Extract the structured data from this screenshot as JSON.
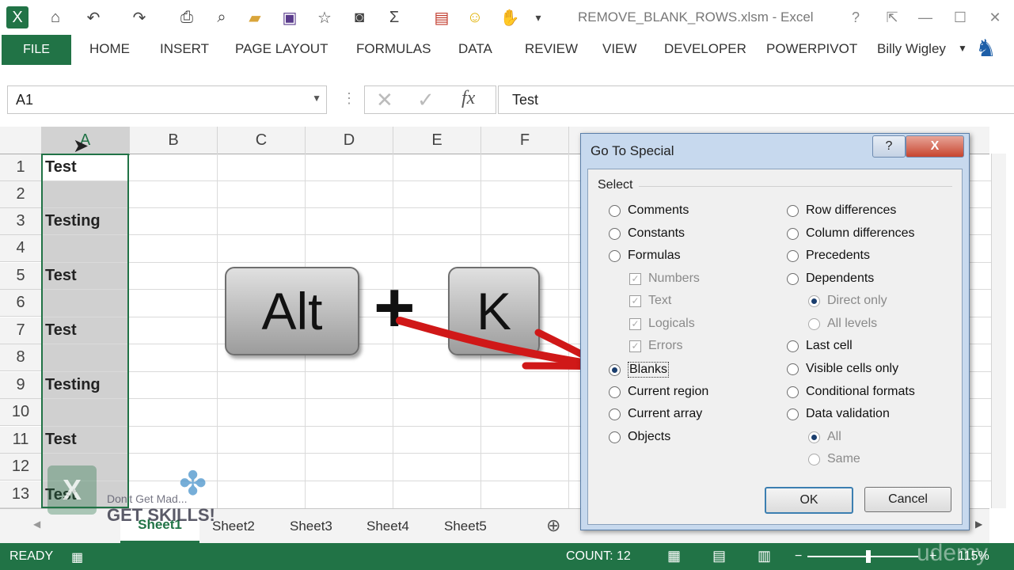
{
  "window": {
    "title": "REMOVE_BLANK_ROWS.xlsm - Excel",
    "user": "Billy Wigley"
  },
  "ribbon": {
    "tabs": [
      "FILE",
      "HOME",
      "INSERT",
      "PAGE LAYOUT",
      "FORMULAS",
      "DATA",
      "REVIEW",
      "VIEW",
      "DEVELOPER",
      "POWERPIVOT"
    ]
  },
  "formula_bar": {
    "name_box": "A1",
    "content": "Test",
    "fx_label": "fx"
  },
  "grid": {
    "columns": [
      "A",
      "B",
      "C",
      "D",
      "E",
      "F"
    ],
    "rows": [
      "1",
      "2",
      "3",
      "4",
      "5",
      "6",
      "7",
      "8",
      "9",
      "10",
      "11",
      "12",
      "13"
    ],
    "col_a_values": [
      "Test",
      "",
      "Testing",
      "",
      "Test",
      "",
      "Test",
      "",
      "Testing",
      "",
      "Test",
      "",
      "Test"
    ]
  },
  "overlay": {
    "key1": "Alt",
    "plus": "+",
    "key2": "K"
  },
  "sheets": [
    "Sheet1",
    "Sheet2",
    "Sheet3",
    "Sheet4",
    "Sheet5"
  ],
  "status": {
    "mode": "READY",
    "count": "COUNT: 12",
    "zoom": "115%"
  },
  "dialog": {
    "title": "Go To Special",
    "section": "Select",
    "left_options": [
      "Comments",
      "Constants",
      "Formulas"
    ],
    "formula_subs": [
      "Numbers",
      "Text",
      "Logicals",
      "Errors"
    ],
    "left_options2": [
      "Blanks",
      "Current region",
      "Current array",
      "Objects"
    ],
    "right_options": [
      "Row differences",
      "Column differences",
      "Precedents",
      "Dependents"
    ],
    "dependents_subs": [
      "Direct only",
      "All levels"
    ],
    "right_options2": [
      "Last cell",
      "Visible cells only",
      "Conditional formats",
      "Data validation"
    ],
    "validation_subs": [
      "All",
      "Same"
    ],
    "selected": "Blanks",
    "ok": "OK",
    "cancel": "Cancel",
    "help": "?",
    "close": "X"
  },
  "watermark": {
    "line1": "Don't Get Mad...",
    "line2": "GET SKILLS!",
    "brand": "udemy"
  },
  "colors": {
    "excel_green": "#217346",
    "selection_gray": "#d0d0d0",
    "arrow_red": "#d01818"
  }
}
